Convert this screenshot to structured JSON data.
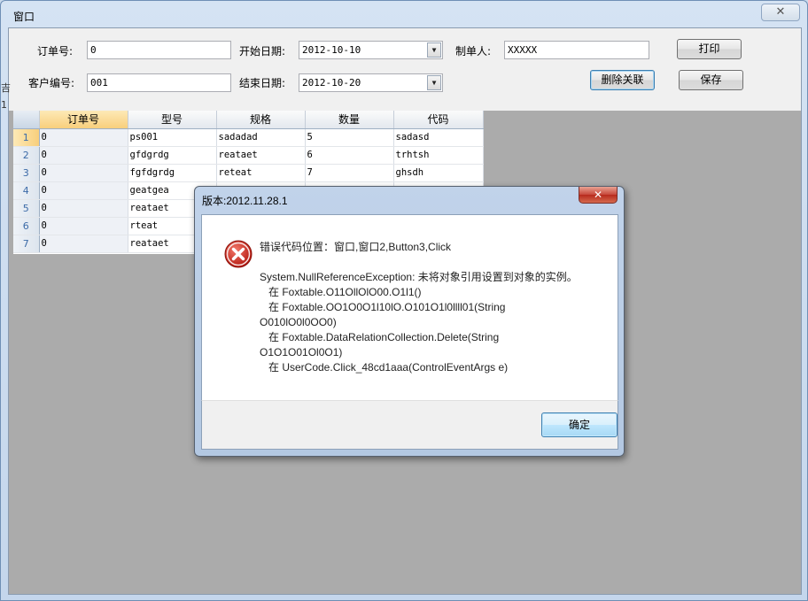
{
  "window": {
    "title": "窗口",
    "close_glyph": "✕"
  },
  "form": {
    "order_no_label": "订单号:",
    "order_no_value": "0",
    "customer_no_label": "客户编号:",
    "customer_no_value": "001",
    "start_date_label": "开始日期:",
    "start_date_value": "2012-10-10",
    "end_date_label": "结束日期:",
    "end_date_value": "2012-10-20",
    "maker_label": "制单人:",
    "maker_value": "XXXXX",
    "print_button": "打印",
    "delete_relation_button": "删除关联",
    "save_button": "保存"
  },
  "edge_text": [
    "吉",
    "1"
  ],
  "grid": {
    "columns": [
      "订单号",
      "型号",
      "规格",
      "数量",
      "代码"
    ],
    "rows": [
      {
        "num": "1",
        "cells": [
          "0",
          "ps001",
          "sadadad",
          "5",
          "sadasd"
        ]
      },
      {
        "num": "2",
        "cells": [
          "0",
          "gfdgrdg",
          "reataet",
          "6",
          "trhtsh"
        ]
      },
      {
        "num": "3",
        "cells": [
          "0",
          "fgfdgrdg",
          "reteat",
          "7",
          "ghsdh"
        ]
      },
      {
        "num": "4",
        "cells": [
          "0",
          "geatgea",
          "",
          "",
          ""
        ]
      },
      {
        "num": "5",
        "cells": [
          "0",
          "reataet",
          "",
          "",
          ""
        ]
      },
      {
        "num": "6",
        "cells": [
          "0",
          "rteat",
          "",
          "",
          ""
        ]
      },
      {
        "num": "7",
        "cells": [
          "0",
          "reataet",
          "",
          "",
          ""
        ]
      }
    ]
  },
  "dialog": {
    "title": "版本:2012.11.28.1",
    "close_glyph": "✕",
    "icon": "error-icon",
    "message_lines": [
      "错误代码位置：窗口,窗口2,Button3,Click",
      "",
      "System.NullReferenceException: 未将对象引用设置到对象的实例。",
      "   在 Foxtable.O11OllOlO00.O1l1()",
      "   在 Foxtable.OO1O0O1l10lO.O101O1l0llll01(String",
      "O010lO0l0OO0)",
      "   在 Foxtable.DataRelationCollection.Delete(String",
      "O1O1O01Ol0O1)",
      "   在 UserCode.Click_48cd1aaa(ControlEventArgs e)"
    ],
    "ok_button": "确定"
  },
  "colors": {
    "accent": "#3c7fb1",
    "error": "#c8281e"
  }
}
